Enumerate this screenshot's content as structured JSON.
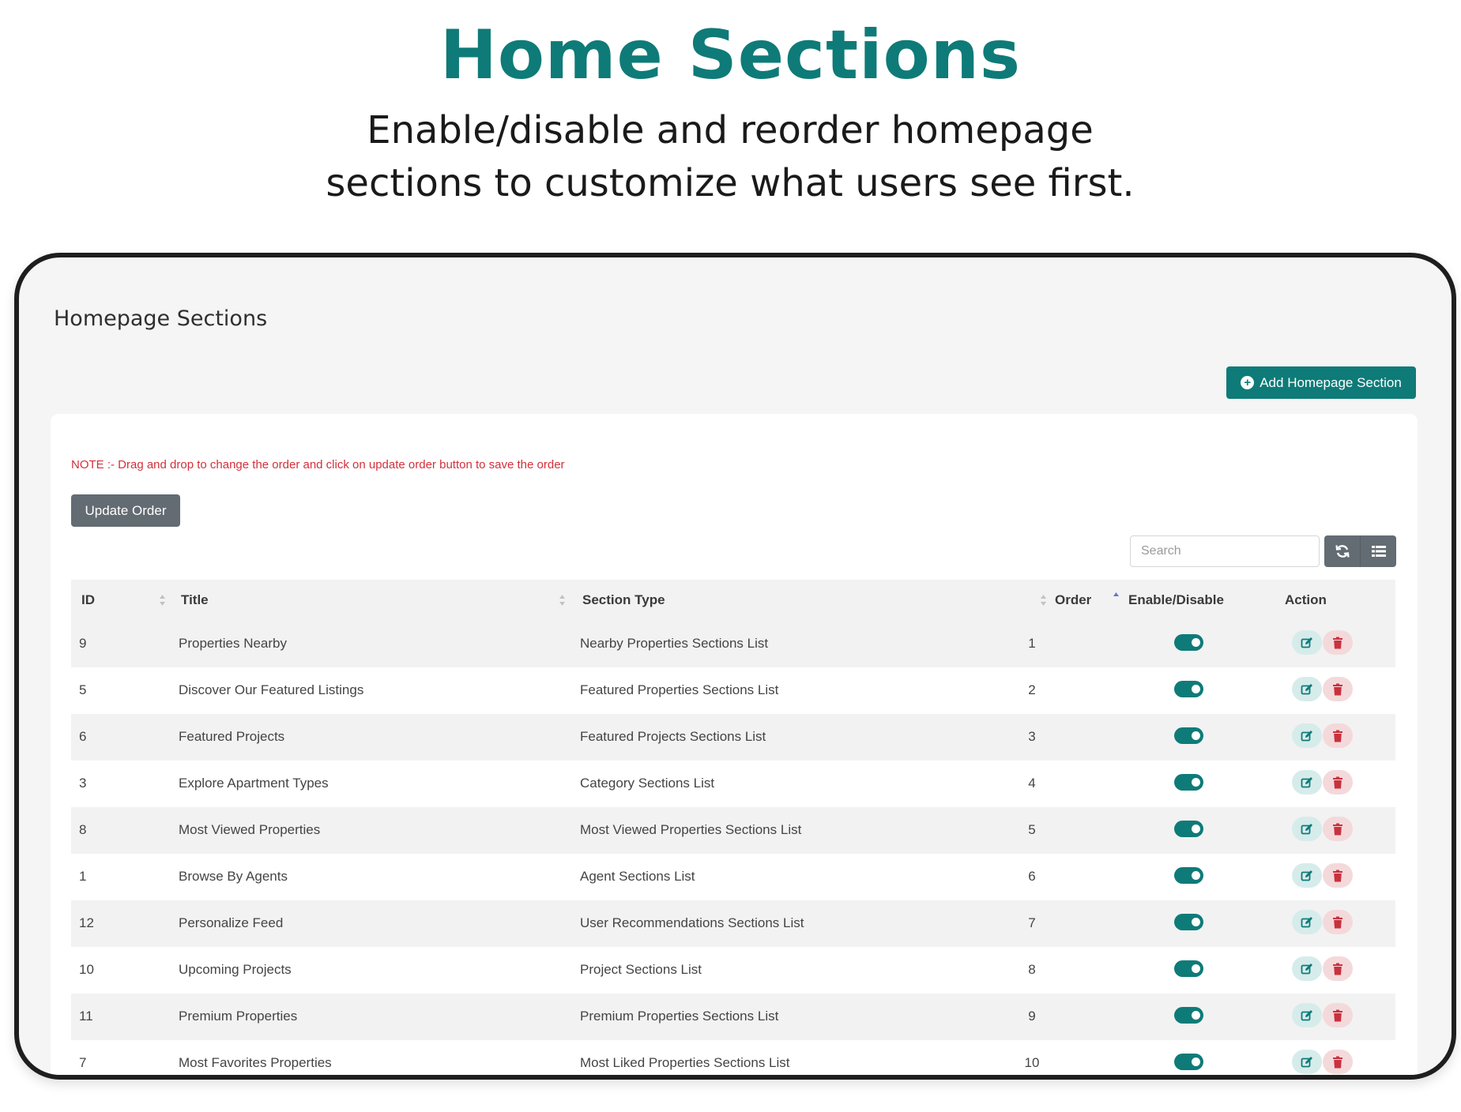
{
  "hero": {
    "title": "Home Sections",
    "subtitle_line1": "Enable/disable and reorder homepage",
    "subtitle_line2": "sections to customize what users see first."
  },
  "panel": {
    "title": "Homepage Sections",
    "add_button": "Add Homepage Section",
    "note": "NOTE :- Drag and drop to change the order and click on update order button to save the order",
    "update_button": "Update Order",
    "search_placeholder": "Search"
  },
  "table": {
    "columns": [
      "ID",
      "Title",
      "Section Type",
      "Order",
      "Enable/Disable",
      "Action"
    ],
    "sorted_by": "Order",
    "rows": [
      {
        "id": "9",
        "title": "Properties Nearby",
        "type": "Nearby Properties Sections List",
        "order": "1",
        "enabled": true
      },
      {
        "id": "5",
        "title": "Discover Our Featured Listings",
        "type": "Featured Properties Sections List",
        "order": "2",
        "enabled": true
      },
      {
        "id": "6",
        "title": "Featured Projects",
        "type": "Featured Projects Sections List",
        "order": "3",
        "enabled": true
      },
      {
        "id": "3",
        "title": "Explore Apartment Types",
        "type": "Category Sections List",
        "order": "4",
        "enabled": true
      },
      {
        "id": "8",
        "title": "Most Viewed Properties",
        "type": "Most Viewed Properties Sections List",
        "order": "5",
        "enabled": true
      },
      {
        "id": "1",
        "title": "Browse By Agents",
        "type": "Agent Sections List",
        "order": "6",
        "enabled": true
      },
      {
        "id": "12",
        "title": "Personalize Feed",
        "type": "User Recommendations Sections List",
        "order": "7",
        "enabled": true
      },
      {
        "id": "10",
        "title": "Upcoming Projects",
        "type": "Project Sections List",
        "order": "8",
        "enabled": true
      },
      {
        "id": "11",
        "title": "Premium Properties",
        "type": "Premium Properties Sections List",
        "order": "9",
        "enabled": true
      },
      {
        "id": "7",
        "title": "Most Favorites Properties",
        "type": "Most Liked Properties Sections List",
        "order": "10",
        "enabled": true
      }
    ]
  },
  "icons": {
    "add": "plus-circle-icon",
    "refresh": "refresh-icon",
    "columns": "list-icon",
    "edit": "edit-icon",
    "delete": "trash-icon",
    "sort": "sort-icon"
  },
  "colors": {
    "brand": "#0e7b78",
    "note": "#d3303a",
    "secondary_button": "#636b73",
    "delete": "#c8323e",
    "sort_active": "#6a72d6"
  }
}
